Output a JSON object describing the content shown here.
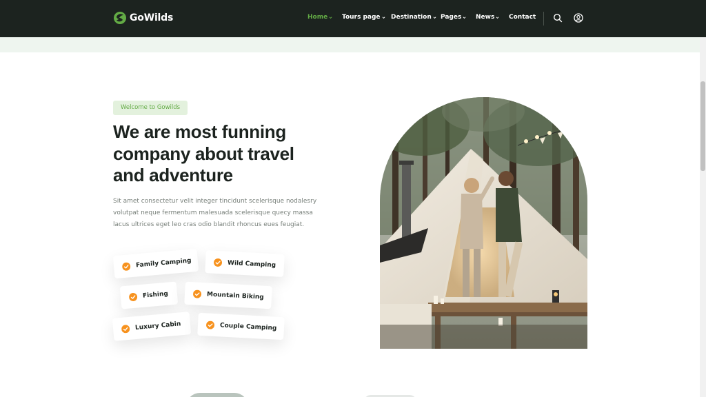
{
  "header": {
    "logo_text": "GoWilds",
    "nav": [
      {
        "label": "Home",
        "dropdown": true,
        "active": true
      },
      {
        "label": "Tours page",
        "dropdown": true,
        "active": false
      },
      {
        "label": "Destination",
        "dropdown": true,
        "active": false
      },
      {
        "label": "Pages",
        "dropdown": true,
        "active": false
      },
      {
        "label": "News",
        "dropdown": true,
        "active": false
      },
      {
        "label": "Contact",
        "dropdown": false,
        "active": false
      }
    ],
    "icons": [
      "search-icon",
      "user-icon"
    ]
  },
  "about": {
    "tag": "Welcome to Gowilds",
    "heading": "We are most funning company about travel and adventure",
    "description": "Sit amet consectetur velit integer tincidunt scelerisque nodalesry volutpat neque fermentum malesuada scelerisque quecy massa lacus ultrices eget leo cras odio blandit rhoncus eues feugiat.",
    "features": [
      {
        "label": "Family Camping"
      },
      {
        "label": "Wild Camping"
      },
      {
        "label": "Fishing"
      },
      {
        "label": "Mountain Biking"
      },
      {
        "label": "Luxury Cabin"
      },
      {
        "label": "Couple Camping"
      }
    ],
    "image_alt": "couple-dancing-at-tent-photo"
  },
  "colors": {
    "header_bg": "#1c231f",
    "accent_green": "#63ab45",
    "check_orange": "#f7921e",
    "tag_bg": "#e3f1dd"
  }
}
